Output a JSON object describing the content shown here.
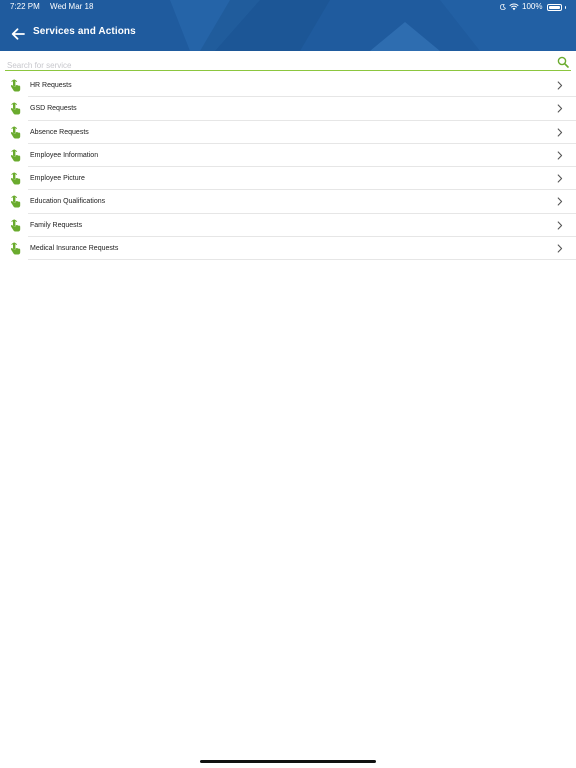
{
  "status_bar": {
    "time": "7:22 PM",
    "date": "Wed Mar 18",
    "battery": "100%",
    "icons": [
      "moon-icon",
      "wifi-icon",
      "battery-icon"
    ]
  },
  "nav": {
    "title": "Services and Actions",
    "back_icon": "arrow-left-icon"
  },
  "search": {
    "placeholder": "Search for service",
    "value": "",
    "icon": "search-icon"
  },
  "colors": {
    "header": "#1f5b9e",
    "accent_green": "#8cc63f",
    "icon_green": "#6aab2e"
  },
  "services": {
    "items": [
      {
        "label": "HR Requests",
        "icon": "touch-hand-icon"
      },
      {
        "label": "GSD Requests",
        "icon": "touch-hand-icon"
      },
      {
        "label": "Absence Requests",
        "icon": "touch-hand-icon"
      },
      {
        "label": "Employee Information",
        "icon": "touch-hand-icon"
      },
      {
        "label": "Employee Picture",
        "icon": "touch-hand-icon"
      },
      {
        "label": "Education Qualifications",
        "icon": "touch-hand-icon"
      },
      {
        "label": "Family Requests",
        "icon": "touch-hand-icon"
      },
      {
        "label": "Medical Insurance Requests",
        "icon": "touch-hand-icon"
      }
    ]
  }
}
